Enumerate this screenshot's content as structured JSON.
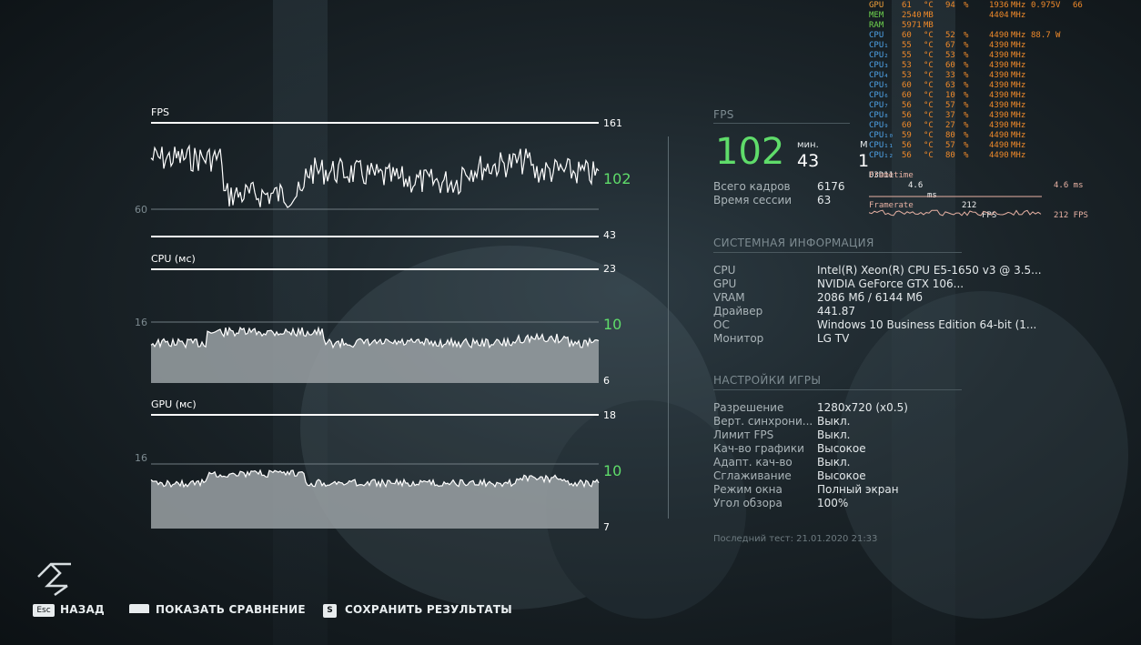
{
  "graphs": {
    "fps": {
      "label": "FPS",
      "max": "161",
      "min": "43",
      "current": "102",
      "ref": "60"
    },
    "cpu": {
      "label": "CPU (мс)",
      "max": "23",
      "min": "6",
      "current": "10",
      "ref": "16"
    },
    "gpu": {
      "label": "GPU (мс)",
      "max": "18",
      "min": "7",
      "current": "10",
      "ref": "16"
    }
  },
  "fps_panel": {
    "title": "FPS",
    "current": "102",
    "min_label": "мин.",
    "min_value": "43",
    "max_label": "М",
    "max_value": "1",
    "stats": [
      {
        "k": "Всего кадров",
        "v": "6176"
      },
      {
        "k": "Время сессии",
        "v": "63"
      }
    ]
  },
  "system_info": {
    "title": "СИСТЕМНАЯ ИНФОРМАЦИЯ",
    "rows": [
      {
        "k": "CPU",
        "v": "Intel(R) Xeon(R) CPU E5-1650 v3 @ 3.5..."
      },
      {
        "k": "GPU",
        "v": "NVIDIA GeForce GTX 106..."
      },
      {
        "k": "VRAM",
        "v": "2086 Мб / 6144 Мб"
      },
      {
        "k": "Драйвер",
        "v": "441.87"
      },
      {
        "k": "ОС",
        "v": "Windows 10 Business Edition 64-bit (1..."
      },
      {
        "k": "Монитор",
        "v": "LG TV"
      }
    ]
  },
  "game_settings": {
    "title": "НАСТРОЙКИ ИГРЫ",
    "rows": [
      {
        "k": "Разрешение",
        "v": "1280x720 (x0.5)"
      },
      {
        "k": "Верт. синхрони...",
        "v": "Выкл."
      },
      {
        "k": "Лимит FPS",
        "v": "Выкл."
      },
      {
        "k": "Кач-во графики",
        "v": "Высокое"
      },
      {
        "k": "Адапт. кач-во",
        "v": "Выкл."
      },
      {
        "k": "Сглаживание",
        "v": "Высокое"
      },
      {
        "k": "Режим окна",
        "v": "Полный экран"
      },
      {
        "k": "Угол обзора",
        "v": "100%"
      }
    ]
  },
  "last_test": "Последний тест: 21.01.2020 21:33",
  "overlay": {
    "rows": [
      {
        "n": "GPU",
        "a": "61",
        "au": "°C",
        "b": "94",
        "bu": "%",
        "c": "1936",
        "cu": "MHz",
        "d": "0.975",
        "du": "V",
        "e": "66"
      },
      {
        "n": "MEM",
        "a": "2540",
        "au": "MB",
        "b": "",
        "bu": "",
        "c": "4404",
        "cu": "MHz",
        "d": "",
        "du": "",
        "e": ""
      },
      {
        "n": "RAM",
        "a": "5971",
        "au": "MB",
        "b": "",
        "bu": "",
        "c": "",
        "cu": "",
        "d": "",
        "du": "",
        "e": ""
      },
      {
        "n": "CPU",
        "a": "60",
        "au": "°C",
        "b": "52",
        "bu": "%",
        "c": "4490",
        "cu": "MHz",
        "d": "88.7",
        "du": "W",
        "e": ""
      },
      {
        "n": "CPU₁",
        "a": "55",
        "au": "°C",
        "b": "67",
        "bu": "%",
        "c": "4390",
        "cu": "MHz",
        "d": "",
        "du": "",
        "e": ""
      },
      {
        "n": "CPU₂",
        "a": "55",
        "au": "°C",
        "b": "53",
        "bu": "%",
        "c": "4390",
        "cu": "MHz",
        "d": "",
        "du": "",
        "e": ""
      },
      {
        "n": "CPU₃",
        "a": "53",
        "au": "°C",
        "b": "60",
        "bu": "%",
        "c": "4390",
        "cu": "MHz",
        "d": "",
        "du": "",
        "e": ""
      },
      {
        "n": "CPU₄",
        "a": "53",
        "au": "°C",
        "b": "33",
        "bu": "%",
        "c": "4390",
        "cu": "MHz",
        "d": "",
        "du": "",
        "e": ""
      },
      {
        "n": "CPU₅",
        "a": "60",
        "au": "°C",
        "b": "63",
        "bu": "%",
        "c": "4390",
        "cu": "MHz",
        "d": "",
        "du": "",
        "e": ""
      },
      {
        "n": "CPU₆",
        "a": "60",
        "au": "°C",
        "b": "10",
        "bu": "%",
        "c": "4390",
        "cu": "MHz",
        "d": "",
        "du": "",
        "e": ""
      },
      {
        "n": "CPU₇",
        "a": "56",
        "au": "°C",
        "b": "57",
        "bu": "%",
        "c": "4390",
        "cu": "MHz",
        "d": "",
        "du": "",
        "e": ""
      },
      {
        "n": "CPU₈",
        "a": "56",
        "au": "°C",
        "b": "37",
        "bu": "%",
        "c": "4390",
        "cu": "MHz",
        "d": "",
        "du": "",
        "e": ""
      },
      {
        "n": "CPU₉",
        "a": "60",
        "au": "°C",
        "b": "27",
        "bu": "%",
        "c": "4390",
        "cu": "MHz",
        "d": "",
        "du": "",
        "e": ""
      },
      {
        "n": "CPU₁₀",
        "a": "59",
        "au": "°C",
        "b": "80",
        "bu": "%",
        "c": "4490",
        "cu": "MHz",
        "d": "",
        "du": "",
        "e": ""
      },
      {
        "n": "CPU₁₁",
        "a": "56",
        "au": "°C",
        "b": "57",
        "bu": "%",
        "c": "4490",
        "cu": "MHz",
        "d": "",
        "du": "",
        "e": ""
      },
      {
        "n": "CPU₁₂",
        "a": "56",
        "au": "°C",
        "b": "80",
        "bu": "%",
        "c": "4490",
        "cu": "MHz",
        "d": "",
        "du": "",
        "e": ""
      }
    ],
    "d3d_label": "D3D11",
    "d3d_ms": "4.6",
    "d3d_ms_unit": "ms",
    "d3d_fps": "212",
    "d3d_fps_unit": "FPS",
    "frametime_label": "Frametime",
    "frametime_value": "4.6 ms",
    "framerate_label": "Framerate",
    "framerate_value": "212 FPS",
    "colors": {
      "gpu": "#f2a13a",
      "mem": "#6fd44e",
      "cpu": "#4fa3e8",
      "val": "#f08a2a",
      "d3d": "#f4f4f4"
    }
  },
  "actions": [
    {
      "key": "Esc",
      "label": "НАЗАД"
    },
    {
      "key": "",
      "label": "ПОКАЗАТЬ СРАВНЕНИЕ"
    },
    {
      "key": "S",
      "label": "СОХРАНИТЬ РЕЗУЛЬТАТЫ"
    }
  ],
  "colors": {
    "accent_green": "#5fdc6a",
    "graph_fill": "#9aa1a4",
    "graph_line": "#ffffff"
  }
}
